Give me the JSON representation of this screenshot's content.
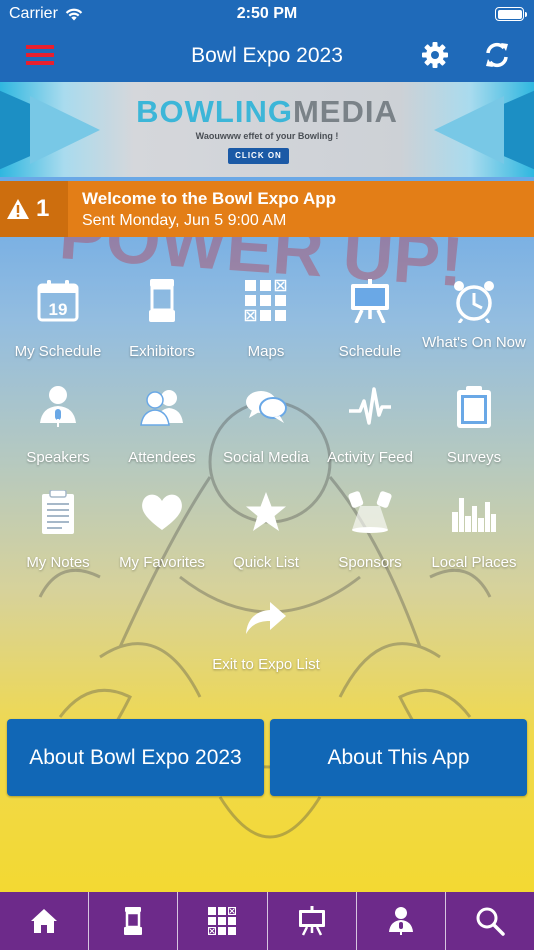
{
  "status_bar": {
    "carrier": "Carrier",
    "time": "2:50 PM"
  },
  "nav": {
    "title": "Bowl Expo 2023",
    "menu_icon": "hamburger-icon",
    "settings_icon": "gear-icon",
    "refresh_icon": "refresh-icon",
    "menu_color": "#e8202e"
  },
  "banner": {
    "logo_part1": "BOWLING",
    "logo_part2": "MEDIA",
    "tagline": "Waouwww effet of your Bowling !",
    "cta": "CLICK ON"
  },
  "alert": {
    "count": "1",
    "title": "Welcome to the Bowl Expo App",
    "subtitle": "Sent Monday, Jun 5 9:00 AM",
    "color": "#e37e17"
  },
  "tiles": [
    {
      "label": "My Schedule",
      "icon": "calendar-icon"
    },
    {
      "label": "Exhibitors",
      "icon": "booth-icon"
    },
    {
      "label": "Maps",
      "icon": "floorplan-icon"
    },
    {
      "label": "Schedule",
      "icon": "easel-icon"
    },
    {
      "label": "What's On Now",
      "icon": "alarm-clock-icon"
    },
    {
      "label": "Speakers",
      "icon": "speaker-icon"
    },
    {
      "label": "Attendees",
      "icon": "people-icon"
    },
    {
      "label": "Social Media",
      "icon": "chat-bubbles-icon"
    },
    {
      "label": "Activity Feed",
      "icon": "pulse-icon"
    },
    {
      "label": "Surveys",
      "icon": "clipboard-icon"
    },
    {
      "label": "My Notes",
      "icon": "notes-icon"
    },
    {
      "label": "My Favorites",
      "icon": "heart-icon"
    },
    {
      "label": "Quick List",
      "icon": "star-icon"
    },
    {
      "label": "Sponsors",
      "icon": "spotlight-icon"
    },
    {
      "label": "Local Places",
      "icon": "city-skyline-icon"
    },
    {
      "label": "Exit to Expo List",
      "icon": "share-arrow-icon"
    }
  ],
  "buttons": {
    "about_expo": "About Bowl Expo 2023",
    "about_app": "About This App",
    "color": "#1167b6"
  },
  "tabbar": {
    "color": "#6d2a8a",
    "tabs": [
      {
        "icon": "home-icon"
      },
      {
        "icon": "booth-icon"
      },
      {
        "icon": "floorplan-icon"
      },
      {
        "icon": "easel-icon"
      },
      {
        "icon": "speaker-icon"
      },
      {
        "icon": "search-icon"
      }
    ]
  }
}
